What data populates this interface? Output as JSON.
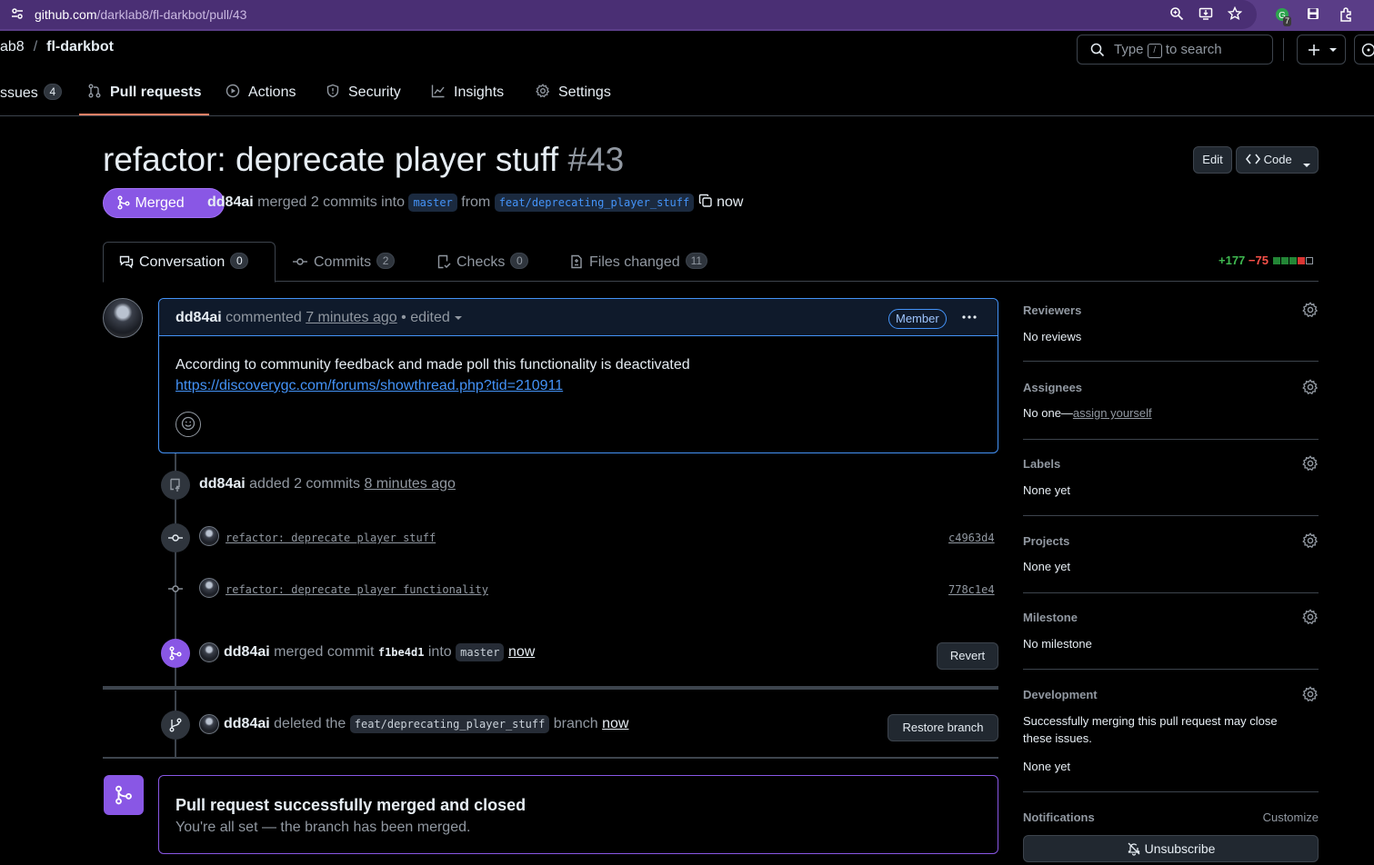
{
  "browser": {
    "url_host": "github.com",
    "url_path": "/darklab8/fl-darkbot/pull/43",
    "ext_badge": "7"
  },
  "repo": {
    "owner_partial": "ab8",
    "separator": "/",
    "name": "fl-darkbot"
  },
  "search": {
    "prefix": "Type",
    "key": "/",
    "suffix": "to search"
  },
  "nav": {
    "issues": {
      "label": "ssues",
      "count": "4"
    },
    "pulls": {
      "label": "Pull requests"
    },
    "actions": {
      "label": "Actions"
    },
    "security": {
      "label": "Security"
    },
    "insights": {
      "label": "Insights"
    },
    "settings": {
      "label": "Settings"
    }
  },
  "pr": {
    "title": "refactor: deprecate player stuff",
    "number": "#43",
    "edit_label": "Edit",
    "code_label": "Code",
    "state": "Merged",
    "author": "dd84ai",
    "merged_text": "merged 2 commits into",
    "base": "master",
    "from_text": "from",
    "head": "feat/deprecating_player_stuff",
    "time": "now"
  },
  "tabs": {
    "conversation": {
      "label": "Conversation",
      "count": "0"
    },
    "commits": {
      "label": "Commits",
      "count": "2"
    },
    "checks": {
      "label": "Checks",
      "count": "0"
    },
    "files": {
      "label": "Files changed",
      "count": "11"
    }
  },
  "diffstat": {
    "additions": "+177",
    "deletions": "−75"
  },
  "colors": {
    "merged": "#8957e5",
    "link": "#4493f8",
    "add": "#3fb950",
    "del": "#f85149"
  },
  "comment": {
    "author": "dd84ai",
    "action": "commented",
    "time": "7 minutes ago",
    "edited": "• edited",
    "role": "Member",
    "body_line1": "According to community feedback and made poll this functionality is deactivated",
    "body_link": "https://discoverygc.com/forums/showthread.php?tid=210911"
  },
  "timeline": {
    "added": {
      "author": "dd84ai",
      "text": "added 2 commits",
      "time": "8 minutes ago"
    },
    "commits": [
      {
        "message": "refactor: deprecate player stuff",
        "sha": "c4963d4"
      },
      {
        "message": "refactor: deprecate player functionality",
        "sha": "778c1e4"
      }
    ],
    "merged": {
      "author": "dd84ai",
      "text1": "merged commit",
      "sha": "f1be4d1",
      "text2": "into",
      "branch": "master",
      "time": "now",
      "button": "Revert"
    },
    "deleted": {
      "author": "dd84ai",
      "text1": "deleted the",
      "branch": "feat/deprecating_player_stuff",
      "text2": "branch",
      "time": "now",
      "button": "Restore branch"
    }
  },
  "mergebox": {
    "heading": "Pull request successfully merged and closed",
    "sub": "You're all set — the branch has been merged."
  },
  "sidebar": {
    "reviewers": {
      "title": "Reviewers",
      "value": "No reviews"
    },
    "assignees": {
      "title": "Assignees",
      "value_prefix": "No one—",
      "value_link": "assign yourself"
    },
    "labels": {
      "title": "Labels",
      "value": "None yet"
    },
    "projects": {
      "title": "Projects",
      "value": "None yet"
    },
    "milestone": {
      "title": "Milestone",
      "value": "No milestone"
    },
    "development": {
      "title": "Development",
      "line1": "Successfully merging this pull request may close",
      "line2": "these issues.",
      "value": "None yet"
    },
    "notifications": {
      "title": "Notifications",
      "customize": "Customize",
      "button": "Unsubscribe"
    }
  }
}
